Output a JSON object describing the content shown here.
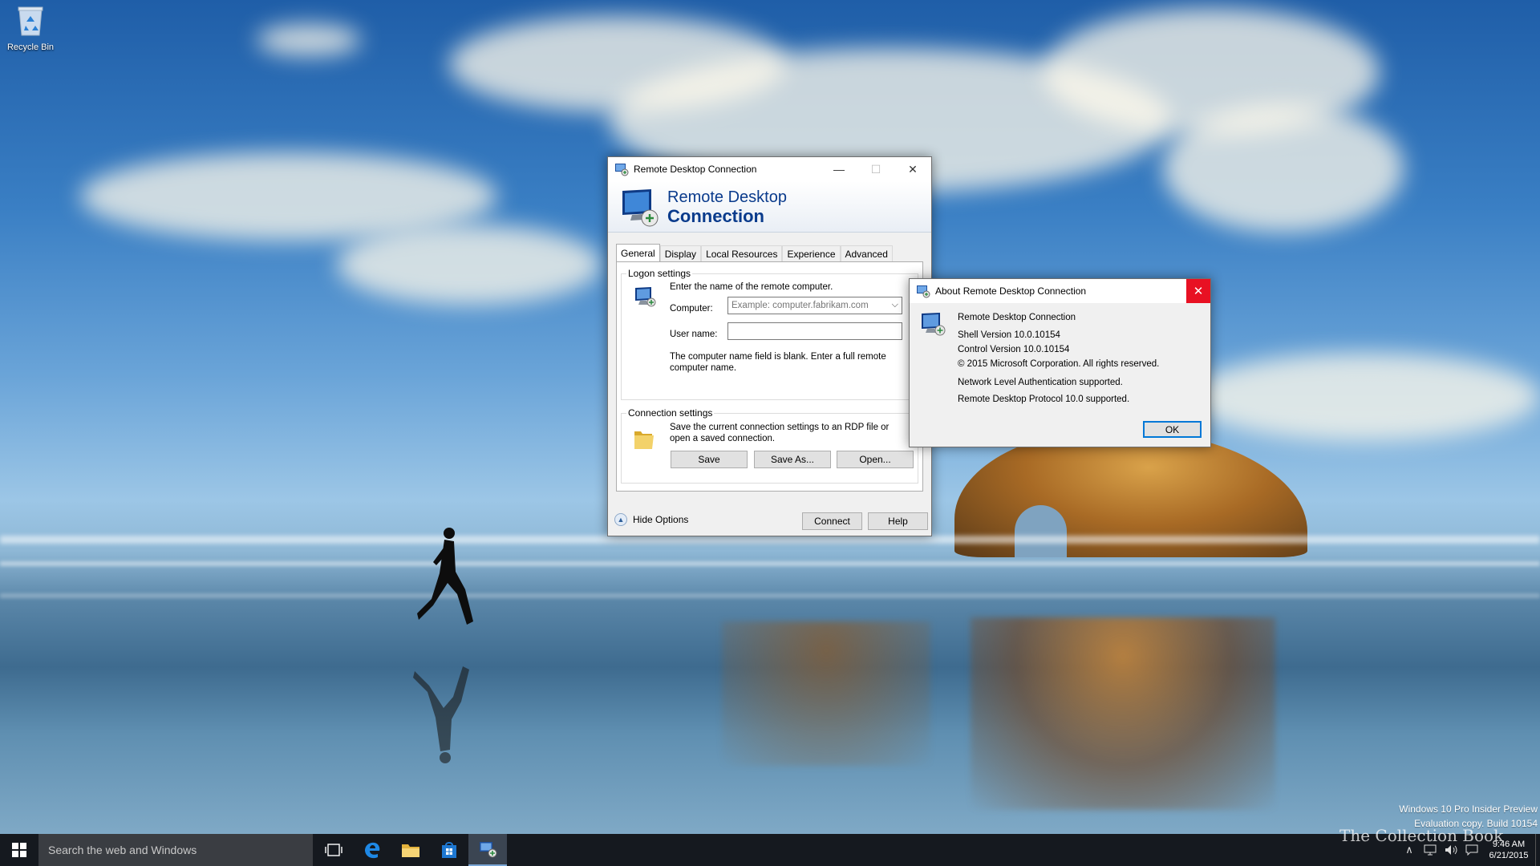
{
  "desktop": {
    "recycle_bin_label": "Recycle Bin",
    "watermark": {
      "line1": "Windows 10 Pro Insider Preview",
      "line2": "Evaluation copy. Build 10154"
    },
    "brand": "The Collection Book"
  },
  "taskbar": {
    "search_placeholder": "Search the web and Windows",
    "clock_time": "9:46 AM",
    "clock_date": "6/21/2015",
    "apps": [
      "task-view",
      "edge",
      "file-explorer",
      "store",
      "remote-desktop"
    ],
    "accent_color": "#0078d7"
  },
  "rdc_window": {
    "title": "Remote Desktop Connection",
    "banner_line1": "Remote Desktop",
    "banner_line2": "Connection",
    "tabs": [
      {
        "label": "General",
        "selected": true
      },
      {
        "label": "Display",
        "selected": false
      },
      {
        "label": "Local Resources",
        "selected": false
      },
      {
        "label": "Experience",
        "selected": false
      },
      {
        "label": "Advanced",
        "selected": false
      }
    ],
    "logon_group_label": "Logon settings",
    "logon_instruction": "Enter the name of the remote computer.",
    "computer_label": "Computer:",
    "computer_placeholder": "Example: computer.fabrikam.com",
    "username_label": "User name:",
    "username_value": "",
    "blank_message": "The computer name field is blank. Enter a full remote computer name.",
    "connection_group_label": "Connection settings",
    "connection_text": "Save the current connection settings to an RDP file or open a saved connection.",
    "save_label": "Save",
    "save_as_label": "Save As...",
    "open_label": "Open...",
    "hide_options_label": "Hide Options",
    "connect_label": "Connect",
    "help_label": "Help"
  },
  "about_window": {
    "title": "About Remote Desktop Connection",
    "app_name": "Remote Desktop Connection",
    "shell_version": "Shell Version 10.0.10154",
    "control_version": "Control Version 10.0.10154",
    "copyright": "© 2015 Microsoft Corporation. All rights reserved.",
    "nla": "Network Level Authentication supported.",
    "protocol": "Remote Desktop Protocol 10.0 supported.",
    "ok_label": "OK",
    "close_color": "#e81123"
  }
}
